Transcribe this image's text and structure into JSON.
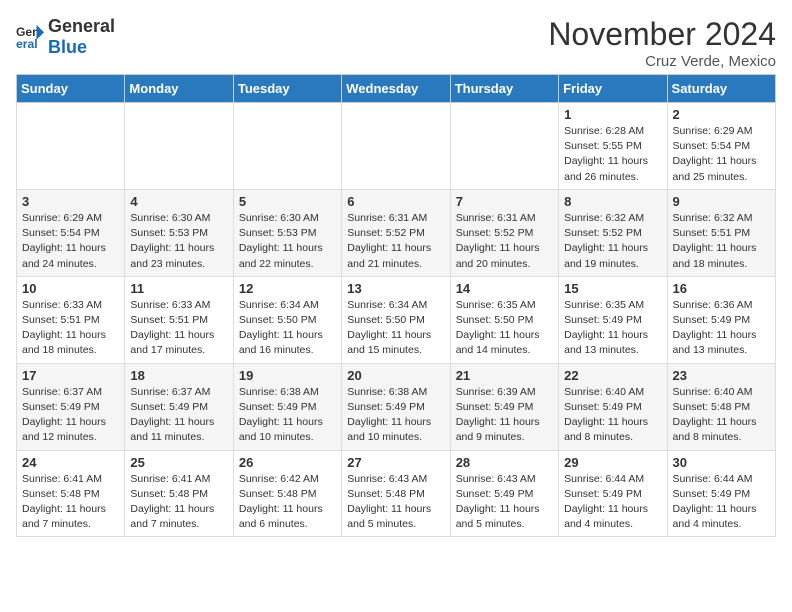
{
  "header": {
    "logo_general": "General",
    "logo_blue": "Blue",
    "month_title": "November 2024",
    "location": "Cruz Verde, Mexico"
  },
  "days_of_week": [
    "Sunday",
    "Monday",
    "Tuesday",
    "Wednesday",
    "Thursday",
    "Friday",
    "Saturday"
  ],
  "weeks": [
    [
      {
        "day": "",
        "info": ""
      },
      {
        "day": "",
        "info": ""
      },
      {
        "day": "",
        "info": ""
      },
      {
        "day": "",
        "info": ""
      },
      {
        "day": "",
        "info": ""
      },
      {
        "day": "1",
        "info": "Sunrise: 6:28 AM\nSunset: 5:55 PM\nDaylight: 11 hours and 26 minutes."
      },
      {
        "day": "2",
        "info": "Sunrise: 6:29 AM\nSunset: 5:54 PM\nDaylight: 11 hours and 25 minutes."
      }
    ],
    [
      {
        "day": "3",
        "info": "Sunrise: 6:29 AM\nSunset: 5:54 PM\nDaylight: 11 hours and 24 minutes."
      },
      {
        "day": "4",
        "info": "Sunrise: 6:30 AM\nSunset: 5:53 PM\nDaylight: 11 hours and 23 minutes."
      },
      {
        "day": "5",
        "info": "Sunrise: 6:30 AM\nSunset: 5:53 PM\nDaylight: 11 hours and 22 minutes."
      },
      {
        "day": "6",
        "info": "Sunrise: 6:31 AM\nSunset: 5:52 PM\nDaylight: 11 hours and 21 minutes."
      },
      {
        "day": "7",
        "info": "Sunrise: 6:31 AM\nSunset: 5:52 PM\nDaylight: 11 hours and 20 minutes."
      },
      {
        "day": "8",
        "info": "Sunrise: 6:32 AM\nSunset: 5:52 PM\nDaylight: 11 hours and 19 minutes."
      },
      {
        "day": "9",
        "info": "Sunrise: 6:32 AM\nSunset: 5:51 PM\nDaylight: 11 hours and 18 minutes."
      }
    ],
    [
      {
        "day": "10",
        "info": "Sunrise: 6:33 AM\nSunset: 5:51 PM\nDaylight: 11 hours and 18 minutes."
      },
      {
        "day": "11",
        "info": "Sunrise: 6:33 AM\nSunset: 5:51 PM\nDaylight: 11 hours and 17 minutes."
      },
      {
        "day": "12",
        "info": "Sunrise: 6:34 AM\nSunset: 5:50 PM\nDaylight: 11 hours and 16 minutes."
      },
      {
        "day": "13",
        "info": "Sunrise: 6:34 AM\nSunset: 5:50 PM\nDaylight: 11 hours and 15 minutes."
      },
      {
        "day": "14",
        "info": "Sunrise: 6:35 AM\nSunset: 5:50 PM\nDaylight: 11 hours and 14 minutes."
      },
      {
        "day": "15",
        "info": "Sunrise: 6:35 AM\nSunset: 5:49 PM\nDaylight: 11 hours and 13 minutes."
      },
      {
        "day": "16",
        "info": "Sunrise: 6:36 AM\nSunset: 5:49 PM\nDaylight: 11 hours and 13 minutes."
      }
    ],
    [
      {
        "day": "17",
        "info": "Sunrise: 6:37 AM\nSunset: 5:49 PM\nDaylight: 11 hours and 12 minutes."
      },
      {
        "day": "18",
        "info": "Sunrise: 6:37 AM\nSunset: 5:49 PM\nDaylight: 11 hours and 11 minutes."
      },
      {
        "day": "19",
        "info": "Sunrise: 6:38 AM\nSunset: 5:49 PM\nDaylight: 11 hours and 10 minutes."
      },
      {
        "day": "20",
        "info": "Sunrise: 6:38 AM\nSunset: 5:49 PM\nDaylight: 11 hours and 10 minutes."
      },
      {
        "day": "21",
        "info": "Sunrise: 6:39 AM\nSunset: 5:49 PM\nDaylight: 11 hours and 9 minutes."
      },
      {
        "day": "22",
        "info": "Sunrise: 6:40 AM\nSunset: 5:49 PM\nDaylight: 11 hours and 8 minutes."
      },
      {
        "day": "23",
        "info": "Sunrise: 6:40 AM\nSunset: 5:48 PM\nDaylight: 11 hours and 8 minutes."
      }
    ],
    [
      {
        "day": "24",
        "info": "Sunrise: 6:41 AM\nSunset: 5:48 PM\nDaylight: 11 hours and 7 minutes."
      },
      {
        "day": "25",
        "info": "Sunrise: 6:41 AM\nSunset: 5:48 PM\nDaylight: 11 hours and 7 minutes."
      },
      {
        "day": "26",
        "info": "Sunrise: 6:42 AM\nSunset: 5:48 PM\nDaylight: 11 hours and 6 minutes."
      },
      {
        "day": "27",
        "info": "Sunrise: 6:43 AM\nSunset: 5:48 PM\nDaylight: 11 hours and 5 minutes."
      },
      {
        "day": "28",
        "info": "Sunrise: 6:43 AM\nSunset: 5:49 PM\nDaylight: 11 hours and 5 minutes."
      },
      {
        "day": "29",
        "info": "Sunrise: 6:44 AM\nSunset: 5:49 PM\nDaylight: 11 hours and 4 minutes."
      },
      {
        "day": "30",
        "info": "Sunrise: 6:44 AM\nSunset: 5:49 PM\nDaylight: 11 hours and 4 minutes."
      }
    ]
  ]
}
